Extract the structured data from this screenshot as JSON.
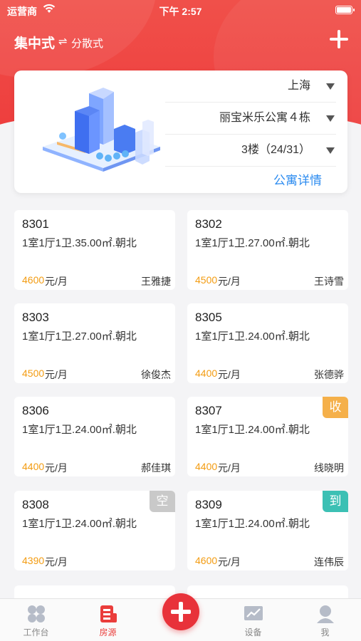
{
  "status_bar": {
    "carrier": "运营商",
    "time": "下午 2:57"
  },
  "header": {
    "mode_active": "集中式",
    "swap_symbol": "⇌",
    "mode_other": "分散式"
  },
  "building": {
    "city": "上海",
    "name": "丽宝米乐公寓４栋",
    "floor": "3楼（24/31）",
    "detail_link": "公寓详情"
  },
  "rooms": [
    {
      "number": "8301",
      "spec": "1室1厅1卫.35.00㎡.朝北",
      "price": "4600",
      "unit": "元/月",
      "tenant": "王雅捷",
      "tag": ""
    },
    {
      "number": "8302",
      "spec": "1室1厅1卫.27.00㎡.朝北",
      "price": "4500",
      "unit": "元/月",
      "tenant": "王诗雪",
      "tag": ""
    },
    {
      "number": "8303",
      "spec": "1室1厅1卫.27.00㎡.朝北",
      "price": "4500",
      "unit": "元/月",
      "tenant": "徐俊杰",
      "tag": ""
    },
    {
      "number": "8305",
      "spec": "1室1厅1卫.24.00㎡.朝北",
      "price": "4400",
      "unit": "元/月",
      "tenant": "张德骅",
      "tag": ""
    },
    {
      "number": "8306",
      "spec": "1室1厅1卫.24.00㎡.朝北",
      "price": "4400",
      "unit": "元/月",
      "tenant": "郝佳琪",
      "tag": ""
    },
    {
      "number": "8307",
      "spec": "1室1厅1卫.24.00㎡.朝北",
      "price": "4400",
      "unit": "元/月",
      "tenant": "线晓明",
      "tag": "收"
    },
    {
      "number": "8308",
      "spec": "1室1厅1卫.24.00㎡.朝北",
      "price": "4390",
      "unit": "元/月",
      "tenant": "",
      "tag": "空"
    },
    {
      "number": "8309",
      "spec": "1室1厅1卫.24.00㎡.朝北",
      "price": "4600",
      "unit": "元/月",
      "tenant": "连伟辰",
      "tag": "到"
    }
  ],
  "tag_colors": {
    "收": "#f5b04a",
    "空": "#c9c9c9",
    "到": "#3cc0b4"
  },
  "colors": {
    "brand_red": "#ee3c3c",
    "link_blue": "#2d8cf0",
    "price_orange": "#f39c12"
  },
  "tabs": [
    {
      "label": "工作台",
      "icon": "workbench-icon"
    },
    {
      "label": "房源",
      "icon": "listing-icon"
    },
    {
      "label": "",
      "icon": "add-icon"
    },
    {
      "label": "设备",
      "icon": "device-chart-icon"
    },
    {
      "label": "我",
      "icon": "profile-icon"
    }
  ]
}
